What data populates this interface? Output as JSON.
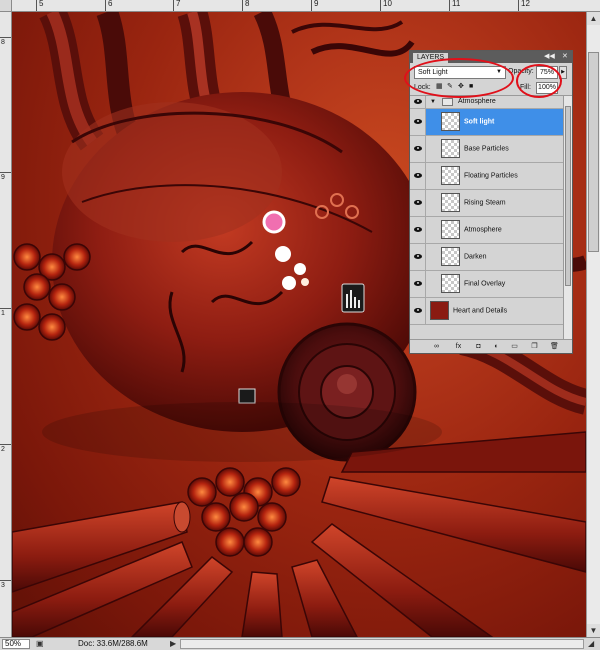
{
  "ruler": {
    "top_labels": [
      "5",
      "6",
      "7",
      "8",
      "9",
      "10",
      "11",
      "12"
    ],
    "left_labels": [
      "8",
      "9",
      "1",
      "2",
      "3"
    ]
  },
  "layers_panel": {
    "tab_label": "LAYERS",
    "blend_mode": "Soft Light",
    "opacity_label": "Opacity:",
    "opacity_value": "75%",
    "lock_label": "Lock:",
    "fill_label": "Fill:",
    "fill_value": "100%",
    "group": {
      "name": "Atmosphere"
    },
    "layers": [
      {
        "name": "Soft light",
        "selected": true
      },
      {
        "name": "Base Particles"
      },
      {
        "name": "Floating Particles"
      },
      {
        "name": "Rising Steam"
      },
      {
        "name": "Atmosphere"
      },
      {
        "name": "Darken"
      },
      {
        "name": "Final Overlay"
      }
    ],
    "bottom_layer": {
      "name": "Heart and Details"
    }
  },
  "status_bar": {
    "zoom": "50%",
    "doc_info": "Doc: 33.6M/288.6M"
  },
  "colors": {
    "selection": "#3f8fe8",
    "annotation": "#e0101a",
    "canvas_base": "#9a2510"
  }
}
